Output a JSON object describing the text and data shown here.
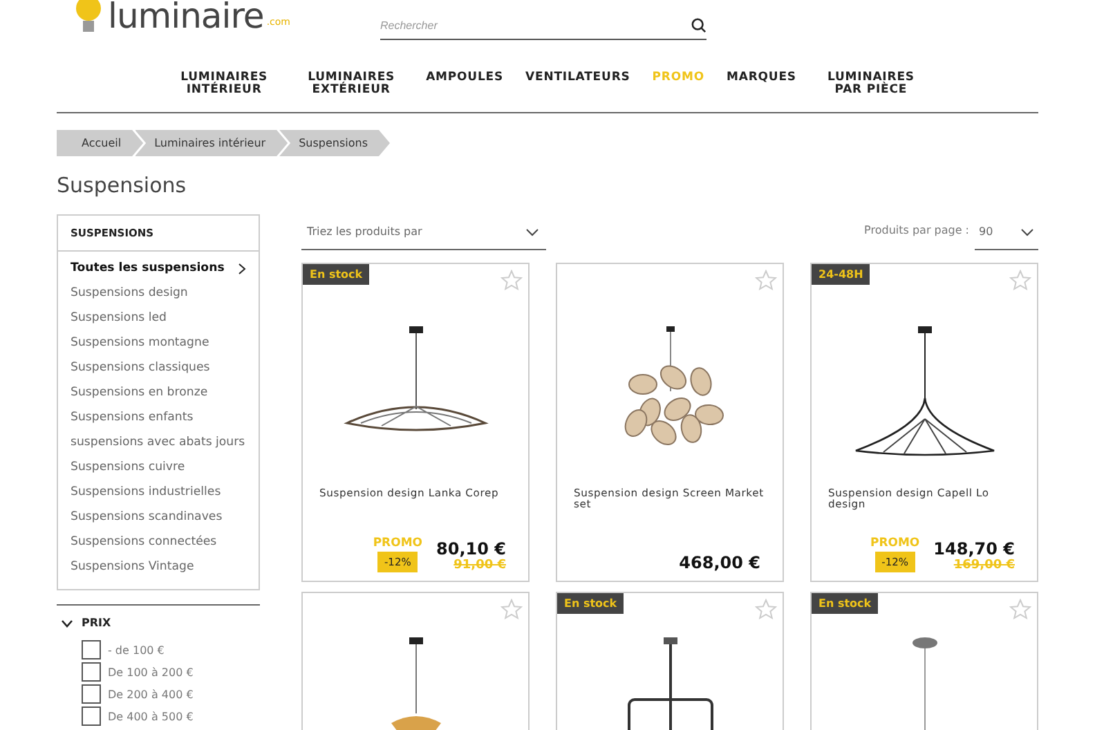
{
  "logo": {
    "name": "luminaire",
    "suffix": ".com"
  },
  "search": {
    "placeholder": "Rechercher"
  },
  "nav": [
    {
      "label": "LUMINAIRES INTÉRIEUR",
      "highlighted": false
    },
    {
      "label": "LUMINAIRES EXTÉRIEUR",
      "highlighted": false
    },
    {
      "label": "AMPOULES",
      "highlighted": false
    },
    {
      "label": "VENTILATEURS",
      "highlighted": false
    },
    {
      "label": "PROMO",
      "highlighted": true
    },
    {
      "label": "MARQUES",
      "highlighted": false
    },
    {
      "label": "LUMINAIRES PAR PIÈCE",
      "highlighted": false
    }
  ],
  "breadcrumb": [
    "Accueil",
    "Luminaires intérieur",
    "Suspensions"
  ],
  "page_title": "Suspensions",
  "sidebar": {
    "title": "SUSPENSIONS",
    "items": [
      {
        "label": "Toutes les suspensions",
        "selected": true
      },
      {
        "label": "Suspensions design",
        "selected": false
      },
      {
        "label": "Suspensions led",
        "selected": false
      },
      {
        "label": "Suspensions montagne",
        "selected": false
      },
      {
        "label": "Suspensions classiques",
        "selected": false
      },
      {
        "label": "Suspensions en bronze",
        "selected": false
      },
      {
        "label": "Suspensions enfants",
        "selected": false
      },
      {
        "label": "suspensions avec abats jours",
        "selected": false
      },
      {
        "label": "Suspensions cuivre",
        "selected": false
      },
      {
        "label": "Suspensions industrielles",
        "selected": false
      },
      {
        "label": "Suspensions scandinaves",
        "selected": false
      },
      {
        "label": "Suspensions connectées",
        "selected": false
      },
      {
        "label": "Suspensions Vintage",
        "selected": false
      }
    ]
  },
  "price_filter": {
    "title": "PRIX",
    "expanded": true,
    "options": [
      {
        "label": "- de 100 €",
        "checked": false
      },
      {
        "label": "De 100 à 200 €",
        "checked": false
      },
      {
        "label": "De 200 à 400 €",
        "checked": false
      },
      {
        "label": "De 400 à 500 €",
        "checked": false
      }
    ]
  },
  "sort": {
    "label": "Triez les produits par"
  },
  "per_page": {
    "label": "Produits par page :",
    "value": "90"
  },
  "products": [
    {
      "badge": "En stock",
      "favorite": false,
      "kind": "flat",
      "name": "Suspension design Lanka Corep",
      "promo": "PROMO",
      "discount": "-12%",
      "price": "80,10 €",
      "old_price": "91,00 €"
    },
    {
      "favorite": false,
      "kind": "petals",
      "name": "Suspension design Screen Market set",
      "price": "468,00 €"
    },
    {
      "badge": "24-48H",
      "favorite": false,
      "kind": "wide",
      "name": "Suspension design Capell Lo design",
      "promo": "PROMO",
      "discount": "-12%",
      "price": "148,70 €",
      "old_price": "169,00 €"
    },
    {
      "favorite": false,
      "kind": "bowl"
    },
    {
      "badge": "En stock",
      "favorite": false,
      "kind": "frame"
    },
    {
      "badge": "En stock",
      "favorite": false,
      "kind": "drop"
    }
  ]
}
